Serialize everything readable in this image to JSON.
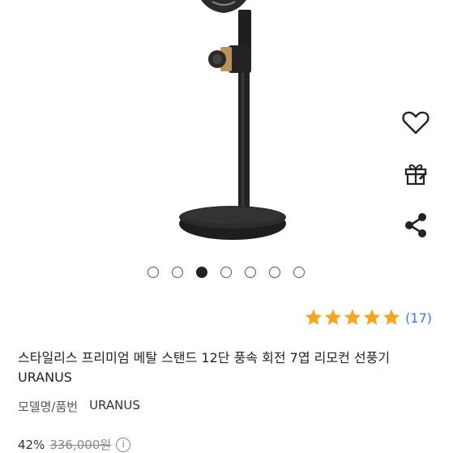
{
  "product": {
    "title_line1": "스타일리스 프리미엄 메탈 스탠드 12단 풍속 회전 7엽 리모컨 선풍기",
    "title_line2": "URANUS"
  },
  "rating": {
    "stars": 5,
    "max_stars": 5,
    "review_count": "(17)",
    "star_color": "#f5a623"
  },
  "carousel": {
    "total": 7,
    "active_index": 2
  },
  "model": {
    "label": "모델명/품번",
    "value": "URANUS"
  },
  "price": {
    "discount": "42%",
    "original": "336,000원",
    "info_glyph": "i"
  },
  "icons": {
    "wishlist": "heart-icon",
    "gift": "gift-icon",
    "share": "share-icon"
  }
}
